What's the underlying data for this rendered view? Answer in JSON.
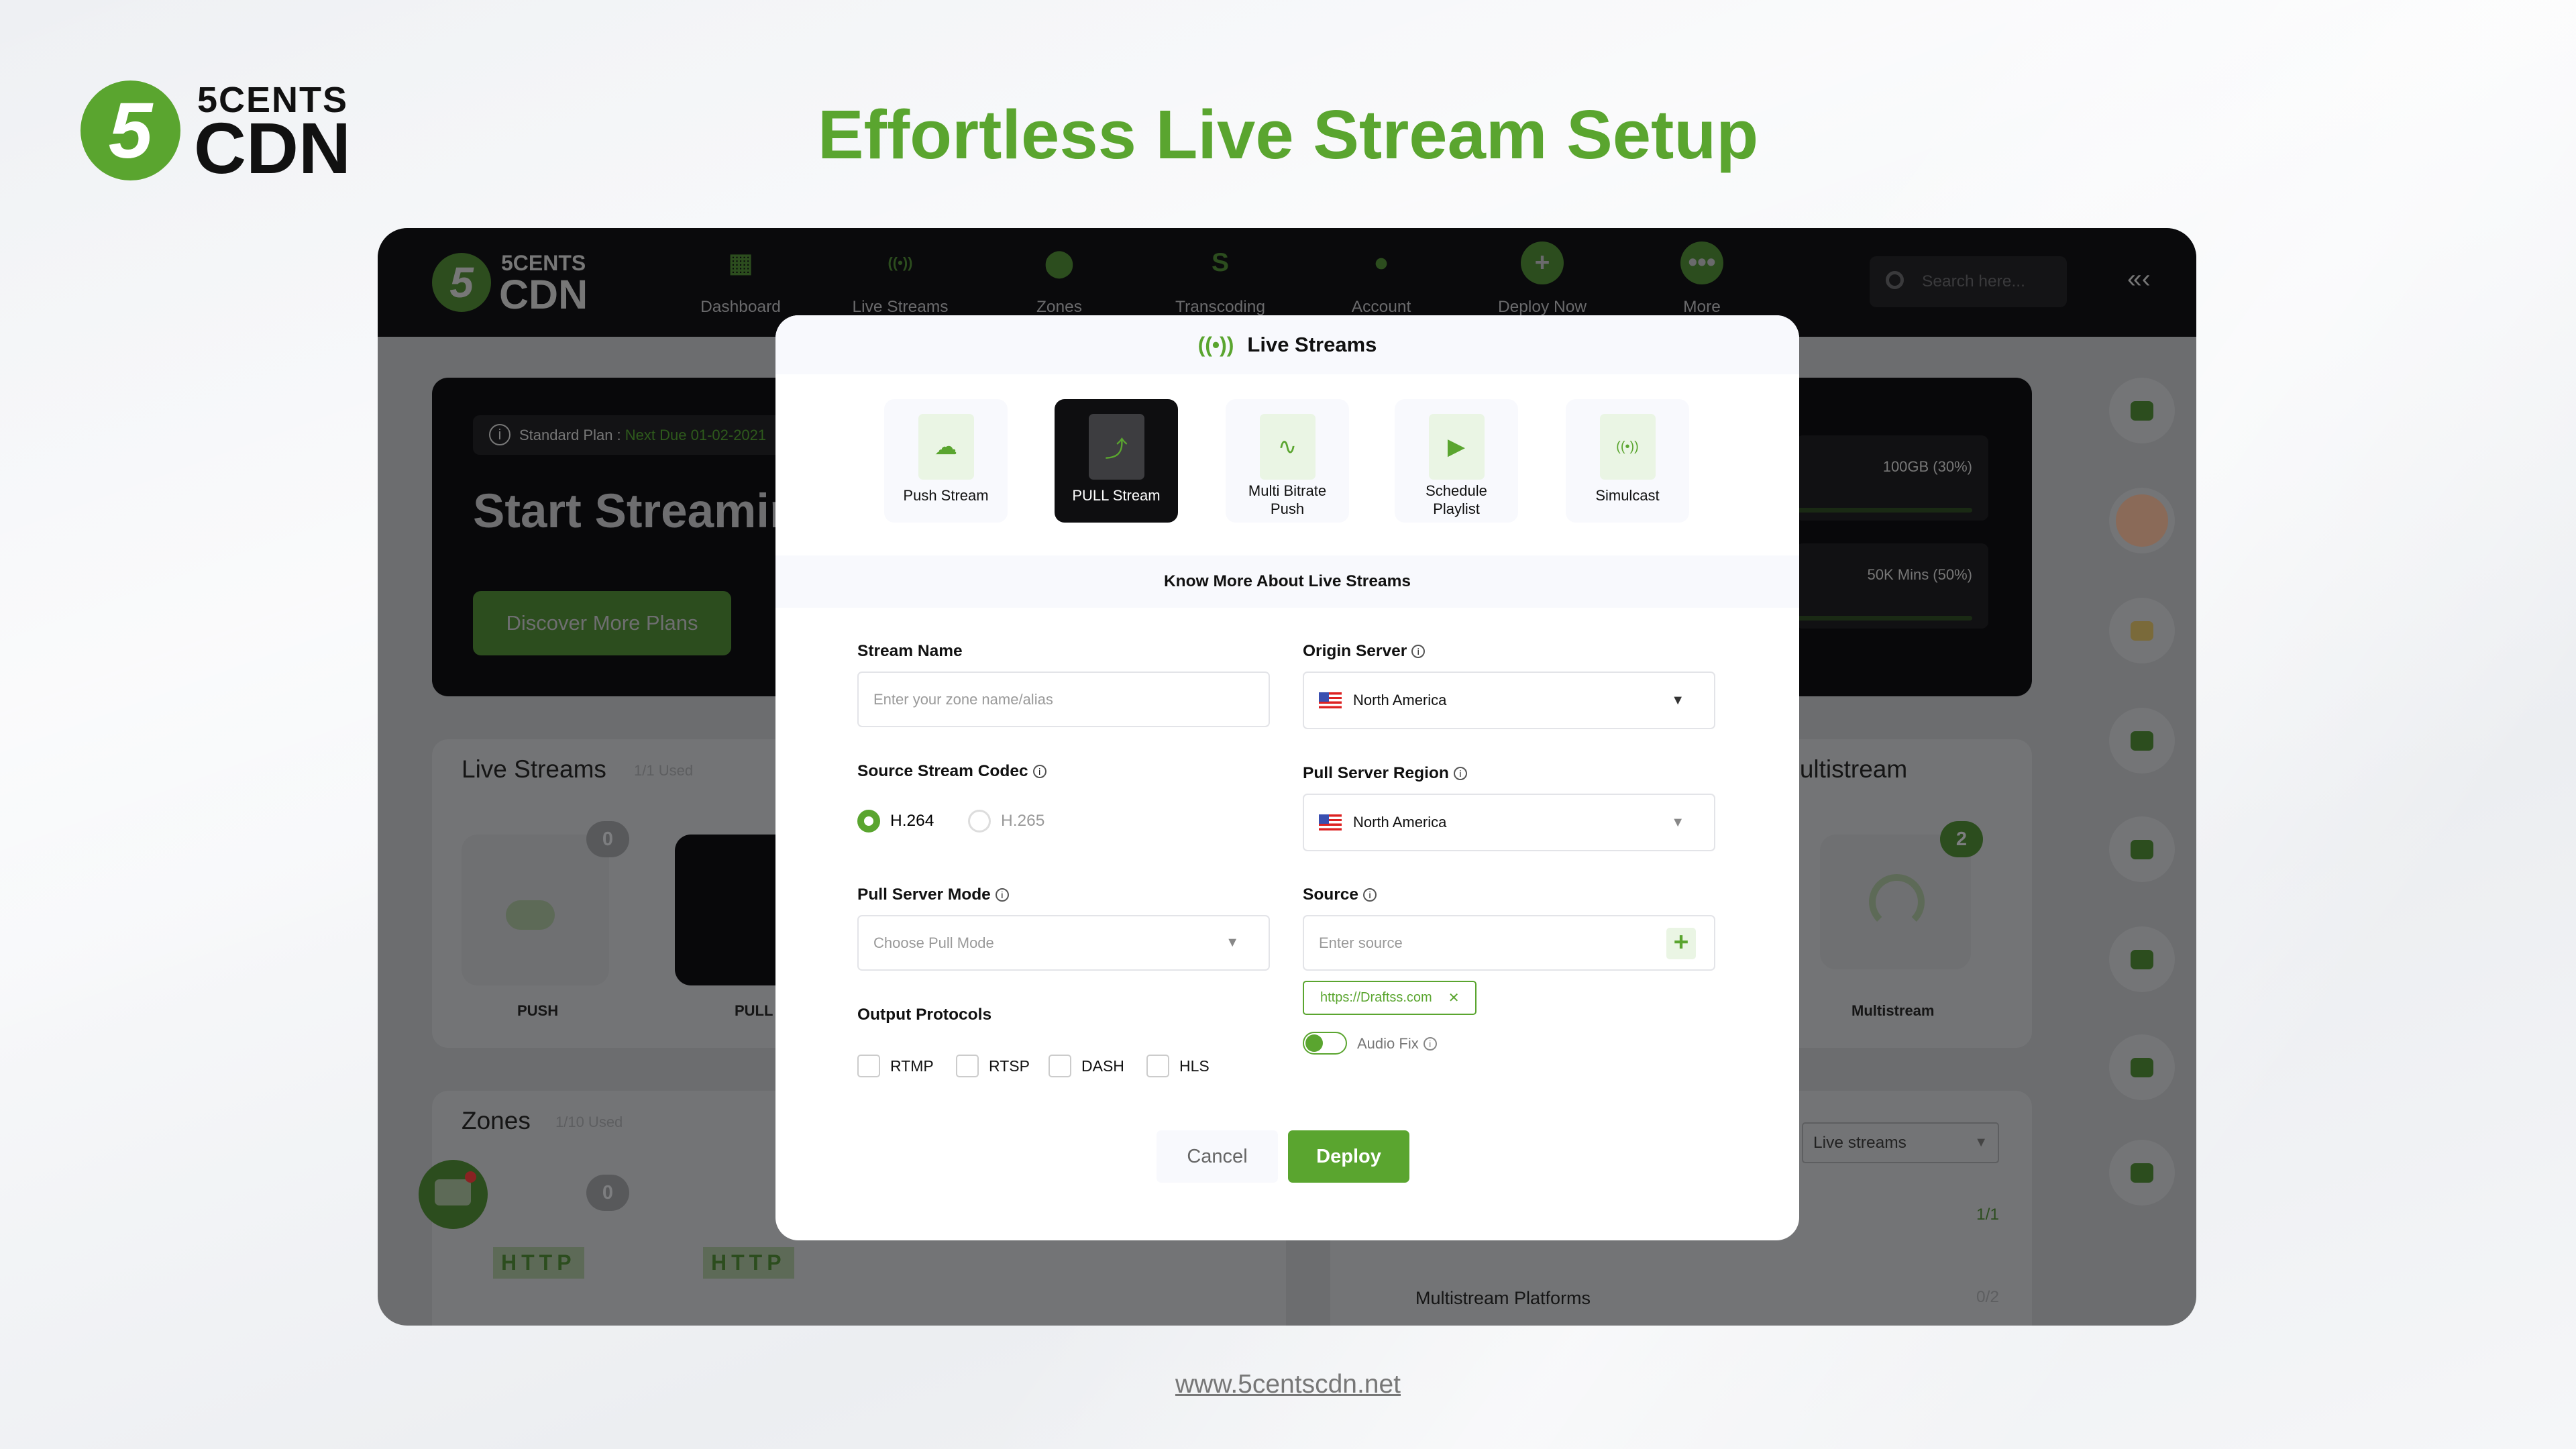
{
  "brand": {
    "logo_top": "5CENTS",
    "logo_bottom": "CDN",
    "logo_digit": "5",
    "color": "#5aa52f"
  },
  "headline": "Effortless Live Stream Setup",
  "app": {
    "nav": [
      {
        "label": "Dashboard",
        "icon": "grid-icon"
      },
      {
        "label": "Live Streams",
        "icon": "broadcast-icon"
      },
      {
        "label": "Zones",
        "icon": "location-icon"
      },
      {
        "label": "Transcoding",
        "icon": "transcoding-icon"
      },
      {
        "label": "Account",
        "icon": "user-icon"
      },
      {
        "label": "Deploy Now",
        "icon": "plus-icon"
      },
      {
        "label": "More",
        "icon": "more-icon"
      }
    ],
    "search_placeholder": "Search here...",
    "plan": {
      "label": "Standard Plan : ",
      "due": "Next Due 01-02-2021"
    },
    "hero_title": "Start Streaming",
    "discover_button": "Discover More Plans",
    "usage": [
      "100GB (30%)",
      "50K Mins (50%)"
    ],
    "usage_percent": [
      30,
      50
    ],
    "live_streams": {
      "title": "Live Streams",
      "used": "1/1 Used",
      "items": [
        {
          "label": "PUSH",
          "count": "0"
        },
        {
          "label": "PULL"
        }
      ]
    },
    "zones": {
      "title": "Zones",
      "used": "1/10 Used",
      "count": "0",
      "items": [
        "HTTP",
        "HTTP"
      ]
    },
    "multistream": {
      "title": "Multistream",
      "count": "2",
      "item": "Multistream"
    },
    "filter": "Live streams",
    "stats": [
      {
        "value": "1/1"
      },
      {
        "label": "Multistream Platforms",
        "value": "0/2"
      }
    ]
  },
  "modal": {
    "title": "Live Streams",
    "types": [
      {
        "label": "Push Stream",
        "icon": "push-stream-icon"
      },
      {
        "label": "PULL Stream",
        "icon": "pull-stream-icon",
        "selected": true
      },
      {
        "label": "Multi Bitrate Push",
        "icon": "multi-bitrate-icon"
      },
      {
        "label": "Schedule Playlist",
        "icon": "schedule-playlist-icon"
      },
      {
        "label": "Simulcast",
        "icon": "simulcast-icon"
      }
    ],
    "know_more": "Know More About Live Streams",
    "stream_name": {
      "label": "Stream Name",
      "placeholder": "Enter your zone name/alias",
      "value": ""
    },
    "origin_server": {
      "label": "Origin Server",
      "value": "North America"
    },
    "codec": {
      "label": "Source Stream Codec",
      "options": [
        "H.264",
        "H.265"
      ],
      "selected": "H.264"
    },
    "pull_region": {
      "label": "Pull Server Region",
      "value": "North America"
    },
    "pull_mode": {
      "label": "Pull Server Mode",
      "placeholder": "Choose Pull Mode"
    },
    "source": {
      "label": "Source",
      "placeholder": "Enter source",
      "tags": [
        "https://Draftss.com"
      ]
    },
    "audio_fix": {
      "label": "Audio Fix",
      "on": true
    },
    "output_protocols": {
      "label": "Output Protocols",
      "options": [
        "RTMP",
        "RTSP",
        "DASH",
        "HLS"
      ],
      "checked": []
    },
    "cancel": "Cancel",
    "deploy": "Deploy"
  },
  "footer_link": "www.5centscdn.net"
}
